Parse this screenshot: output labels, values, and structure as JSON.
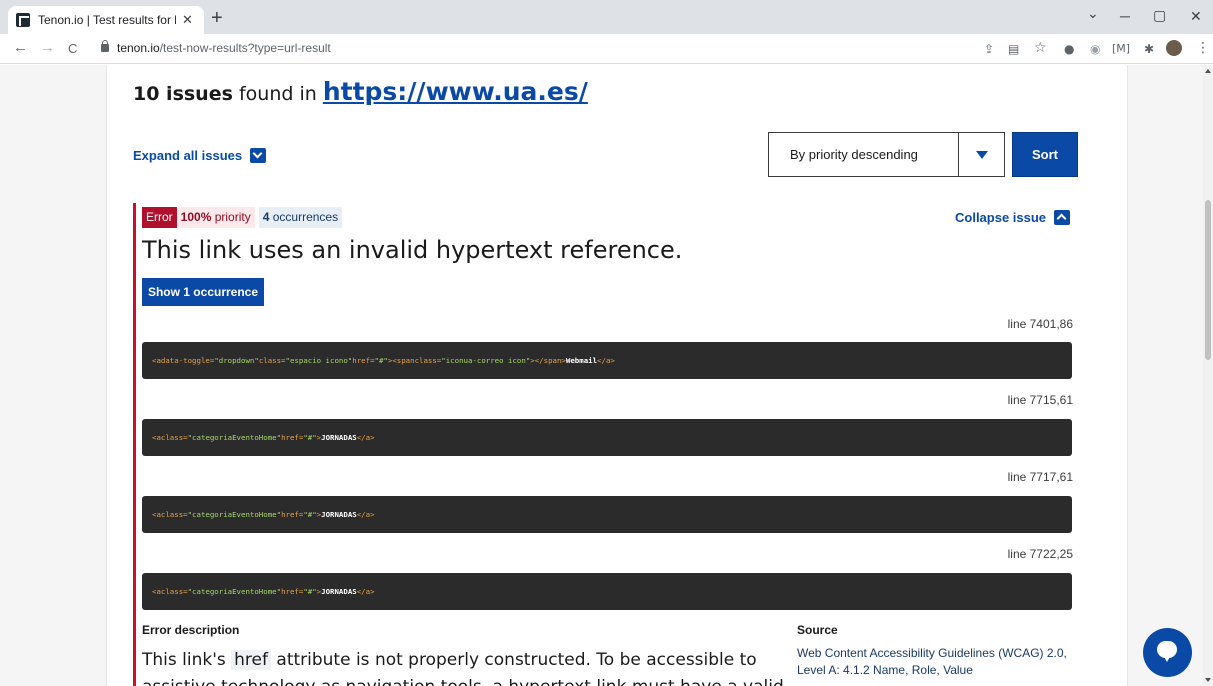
{
  "browser": {
    "tab_title": "Tenon.io | Test results for https://",
    "tab_close": "✕",
    "new_tab": "+",
    "url_domain": "tenon.io",
    "url_path": "/test-now-results?type=url-result",
    "back": "←",
    "forward": "→",
    "reload": "C",
    "minimize": "─",
    "maximize": "▢",
    "close": "✕",
    "tab_search": "⌄",
    "bookmark_star": "☆",
    "extension_m": "[M]",
    "menu_dots": "⋮"
  },
  "results": {
    "count_label": "10 issues",
    "found_in": " found in ",
    "site_url": "https://www.ua.es/"
  },
  "controls": {
    "expand_all_label": "Expand all issues",
    "sort_selected": "By priority descending",
    "sort_button": "Sort"
  },
  "issue": {
    "type": "Error",
    "priority_value": "100%",
    "priority_label": " priority",
    "occurrences_count": "4",
    "occurrences_label": " occurrences",
    "collapse_label": "Collapse issue",
    "title": "This link uses an invalid hypertext reference.",
    "show_occurrence_label": "Show 1 occurrence",
    "occurrences": [
      {
        "line": "line 7401,86",
        "code": [
          {
            "t": "tag",
            "v": "<a "
          },
          {
            "t": "attr",
            "v": "data-toggle="
          },
          {
            "t": "str",
            "v": "\"dropdown\""
          },
          {
            "t": "attr",
            "v": " class="
          },
          {
            "t": "str",
            "v": "\"espacio icono\""
          },
          {
            "t": "attr",
            "v": " href="
          },
          {
            "t": "str",
            "v": "\"#\""
          },
          {
            "t": "tag",
            "v": "><span "
          },
          {
            "t": "attr",
            "v": "class="
          },
          {
            "t": "str",
            "v": "\"iconua-correo icon\""
          },
          {
            "t": "tag",
            "v": "></span>"
          },
          {
            "t": "txt",
            "v": "Webmail"
          },
          {
            "t": "tag",
            "v": "</a>"
          }
        ]
      },
      {
        "line": "line 7715,61",
        "code": [
          {
            "t": "tag",
            "v": "<a "
          },
          {
            "t": "attr",
            "v": "class="
          },
          {
            "t": "str",
            "v": "\"categoriaEventoHome\""
          },
          {
            "t": "attr",
            "v": " href="
          },
          {
            "t": "str",
            "v": "\"#\""
          },
          {
            "t": "tag",
            "v": ">"
          },
          {
            "t": "txt",
            "v": "JORNADAS"
          },
          {
            "t": "tag",
            "v": "</a>"
          }
        ]
      },
      {
        "line": "line 7717,61",
        "code": [
          {
            "t": "tag",
            "v": "<a "
          },
          {
            "t": "attr",
            "v": "class="
          },
          {
            "t": "str",
            "v": "\"categoriaEventoHome\""
          },
          {
            "t": "attr",
            "v": " href="
          },
          {
            "t": "str",
            "v": "\"#\""
          },
          {
            "t": "tag",
            "v": ">"
          },
          {
            "t": "txt",
            "v": "JORNADAS"
          },
          {
            "t": "tag",
            "v": "</a>"
          }
        ]
      },
      {
        "line": "line 7722,25",
        "code": [
          {
            "t": "tag",
            "v": "<a "
          },
          {
            "t": "attr",
            "v": "class="
          },
          {
            "t": "str",
            "v": "\"categoriaEventoHome\""
          },
          {
            "t": "attr",
            "v": " href="
          },
          {
            "t": "str",
            "v": "\"#\""
          },
          {
            "t": "tag",
            "v": ">"
          },
          {
            "t": "txt",
            "v": "JORNADAS"
          },
          {
            "t": "tag",
            "v": "</a>"
          }
        ]
      }
    ],
    "description_heading": "Error description",
    "description_before": "This link's ",
    "description_code": "href",
    "description_after": " attribute is not properly constructed. To be accessible to assistive technology as navigation tools, a hypertext link must have a valid",
    "source_heading": "Source",
    "source_text": "Web Content Accessibility Guidelines (WCAG) 2.0, Level A: 4.1.2 Name, Role, Value"
  },
  "colors": {
    "brand_blue": "#0a4aa6",
    "error_red": "#b0102b",
    "code_bg": "#2b2b2b"
  }
}
